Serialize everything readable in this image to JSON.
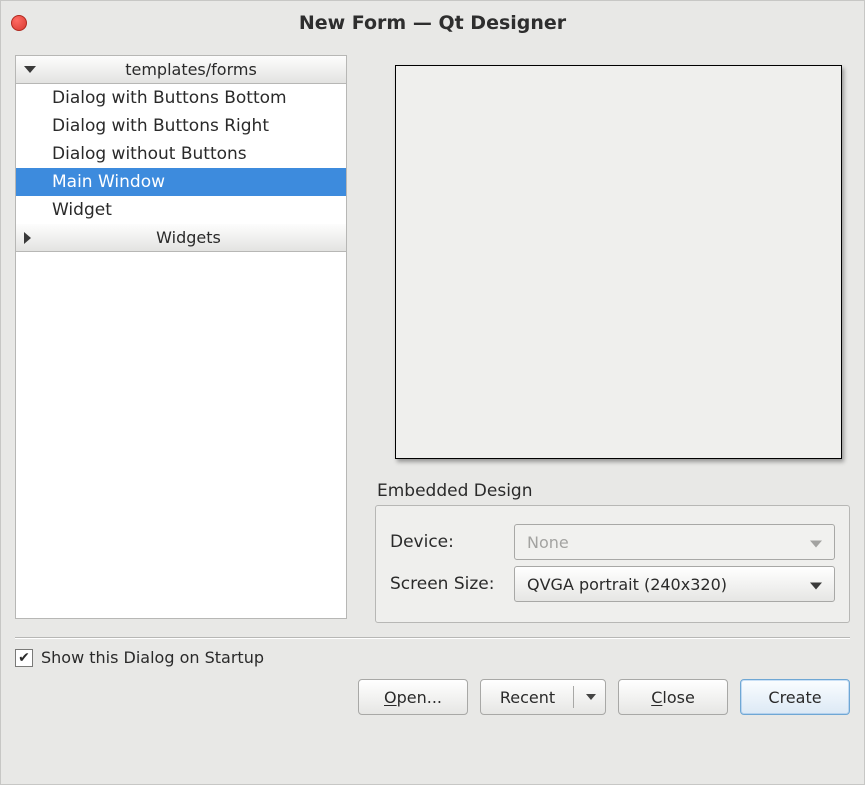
{
  "window": {
    "title": "New Form — Qt Designer"
  },
  "tree": {
    "groups": [
      {
        "label": "templates/forms",
        "expanded": true
      },
      {
        "label": "Widgets",
        "expanded": false
      }
    ],
    "items": [
      {
        "label": "Dialog with Buttons Bottom",
        "selected": false
      },
      {
        "label": "Dialog with Buttons Right",
        "selected": false
      },
      {
        "label": "Dialog without Buttons",
        "selected": false
      },
      {
        "label": "Main Window",
        "selected": true
      },
      {
        "label": "Widget",
        "selected": false
      }
    ]
  },
  "embedded": {
    "title": "Embedded Design",
    "device_label": "Device:",
    "device_value": "None",
    "device_enabled": false,
    "size_label": "Screen Size:",
    "size_value": "QVGA portrait (240x320)"
  },
  "startup": {
    "checkbox_label": "Show this Dialog on Startup",
    "checked": true
  },
  "buttons": {
    "open": "Open...",
    "recent": "Recent",
    "close": "Close",
    "create": "Create"
  }
}
